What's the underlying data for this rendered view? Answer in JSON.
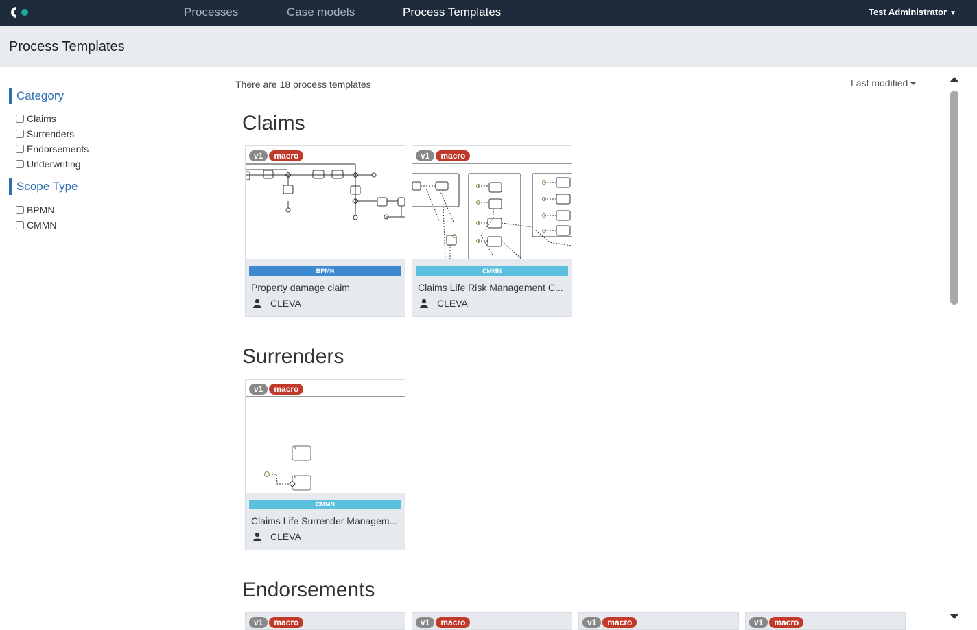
{
  "nav": {
    "items": [
      "Processes",
      "Case models",
      "Process Templates"
    ],
    "active": "Process Templates",
    "user": "Test Administrator"
  },
  "page": {
    "title": "Process Templates"
  },
  "filters": {
    "category": {
      "label": "Category",
      "options": [
        "Claims",
        "Surrenders",
        "Endorsements",
        "Underwriting"
      ]
    },
    "scope": {
      "label": "Scope Type",
      "options": [
        "BPMN",
        "CMMN"
      ]
    }
  },
  "main": {
    "count_text": "There are 18 process templates",
    "sort_label": "Last modified"
  },
  "sections": [
    {
      "title": "Claims",
      "cards": [
        {
          "version": "v1",
          "tag": "macro",
          "type": "BPMN",
          "name": "Property damage claim",
          "owner": "CLEVA"
        },
        {
          "version": "v1",
          "tag": "macro",
          "type": "CMMN",
          "name": "Claims Life Risk Management C...",
          "owner": "CLEVA"
        }
      ]
    },
    {
      "title": "Surrenders",
      "cards": [
        {
          "version": "v1",
          "tag": "macro",
          "type": "CMMN",
          "name": "Claims Life Surrender Managem...",
          "owner": "CLEVA"
        }
      ]
    },
    {
      "title": "Endorsements",
      "cards": [
        {
          "version": "v1",
          "tag": "macro"
        },
        {
          "version": "v1",
          "tag": "macro"
        },
        {
          "version": "v1",
          "tag": "macro"
        },
        {
          "version": "v1",
          "tag": "macro"
        }
      ]
    }
  ],
  "colors": {
    "nav_bg": "#1e2b3c",
    "accent": "#2f6fb0",
    "bpmn": "#3e8ad0",
    "cmmn": "#5bc0de",
    "macro": "#c0392b"
  }
}
